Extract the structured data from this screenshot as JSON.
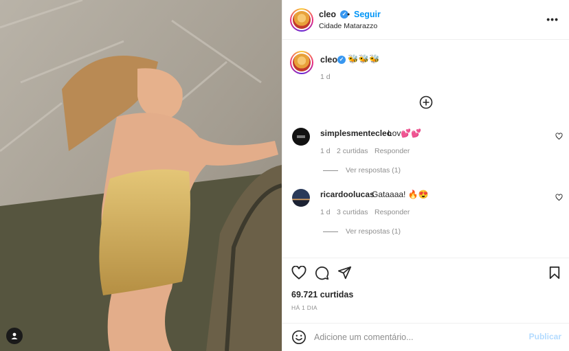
{
  "post": {
    "author": "cleo",
    "follow_label": "Seguir",
    "dot": "•",
    "location": "Cidade Matarazzo",
    "more": "•••",
    "caption": "🐝🐝🐝",
    "caption_age": "1 d"
  },
  "comments": [
    {
      "user": "simplesmentecleo",
      "text": "Lov💕💕",
      "age": "1 d",
      "likes": "2 curtidas",
      "reply": "Responder",
      "view_replies": "Ver respostas (1)"
    },
    {
      "user": "ricardoolucas",
      "text": "Gataaaa! 🔥😍",
      "age": "1 d",
      "likes": "3 curtidas",
      "reply": "Responder",
      "view_replies": "Ver respostas (1)"
    }
  ],
  "stats": {
    "likes": "69.721 curtidas",
    "posted": "HÁ 1 DIA"
  },
  "composer": {
    "placeholder": "Adicione um comentário...",
    "publish": "Publicar"
  },
  "colors": {
    "accent": "#0095f6",
    "verified": "#3897f0",
    "muted": "#8e8e8e",
    "publish_disabled": "#b3dbff"
  },
  "icons": {
    "verified": "verified-badge-icon",
    "more": "more-options-icon",
    "load_more": "plus-circle-icon",
    "like": "heart-icon",
    "comment": "comment-bubble-icon",
    "share": "paper-plane-icon",
    "save": "bookmark-icon",
    "emoji": "emoji-smile-icon",
    "tag": "user-tag-icon"
  }
}
